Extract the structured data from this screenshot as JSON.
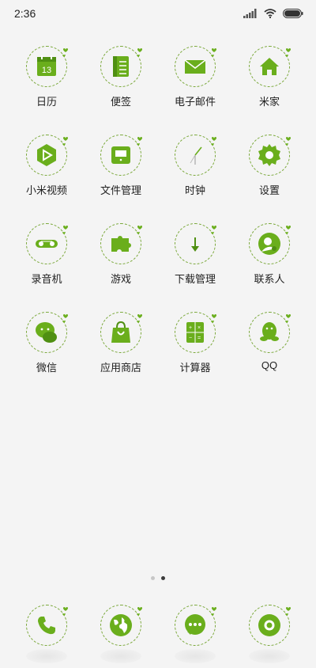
{
  "status_bar": {
    "time": "2:36"
  },
  "colors": {
    "accent": "#6aae1c",
    "accent_dark": "#4f8f12",
    "ring": "#7aa83a"
  },
  "apps": [
    {
      "label": "日历",
      "icon": "calendar-icon",
      "name": "app-calendar",
      "day": "13"
    },
    {
      "label": "便签",
      "icon": "notes-icon",
      "name": "app-notes"
    },
    {
      "label": "电子邮件",
      "icon": "mail-icon",
      "name": "app-email"
    },
    {
      "label": "米家",
      "icon": "home-icon",
      "name": "app-mijia"
    },
    {
      "label": "小米视频",
      "icon": "play-icon",
      "name": "app-video"
    },
    {
      "label": "文件管理",
      "icon": "folder-icon",
      "name": "app-file-manager"
    },
    {
      "label": "时钟",
      "icon": "clock-icon",
      "name": "app-clock"
    },
    {
      "label": "设置",
      "icon": "gear-icon",
      "name": "app-settings"
    },
    {
      "label": "录音机",
      "icon": "recorder-icon",
      "name": "app-recorder"
    },
    {
      "label": "游戏",
      "icon": "puzzle-icon",
      "name": "app-games"
    },
    {
      "label": "下载管理",
      "icon": "download-icon",
      "name": "app-downloads"
    },
    {
      "label": "联系人",
      "icon": "contacts-icon",
      "name": "app-contacts"
    },
    {
      "label": "微信",
      "icon": "wechat-icon",
      "name": "app-wechat"
    },
    {
      "label": "应用商店",
      "icon": "store-icon",
      "name": "app-store"
    },
    {
      "label": "计算器",
      "icon": "calculator-icon",
      "name": "app-calculator"
    },
    {
      "label": "QQ",
      "icon": "qq-icon",
      "name": "app-qq"
    }
  ],
  "pager": {
    "pages": 2,
    "active": 2
  },
  "dock": [
    {
      "icon": "phone-icon",
      "name": "dock-phone"
    },
    {
      "icon": "browser-icon",
      "name": "dock-browser"
    },
    {
      "icon": "messages-icon",
      "name": "dock-messages"
    },
    {
      "icon": "camera-icon",
      "name": "dock-camera"
    }
  ]
}
